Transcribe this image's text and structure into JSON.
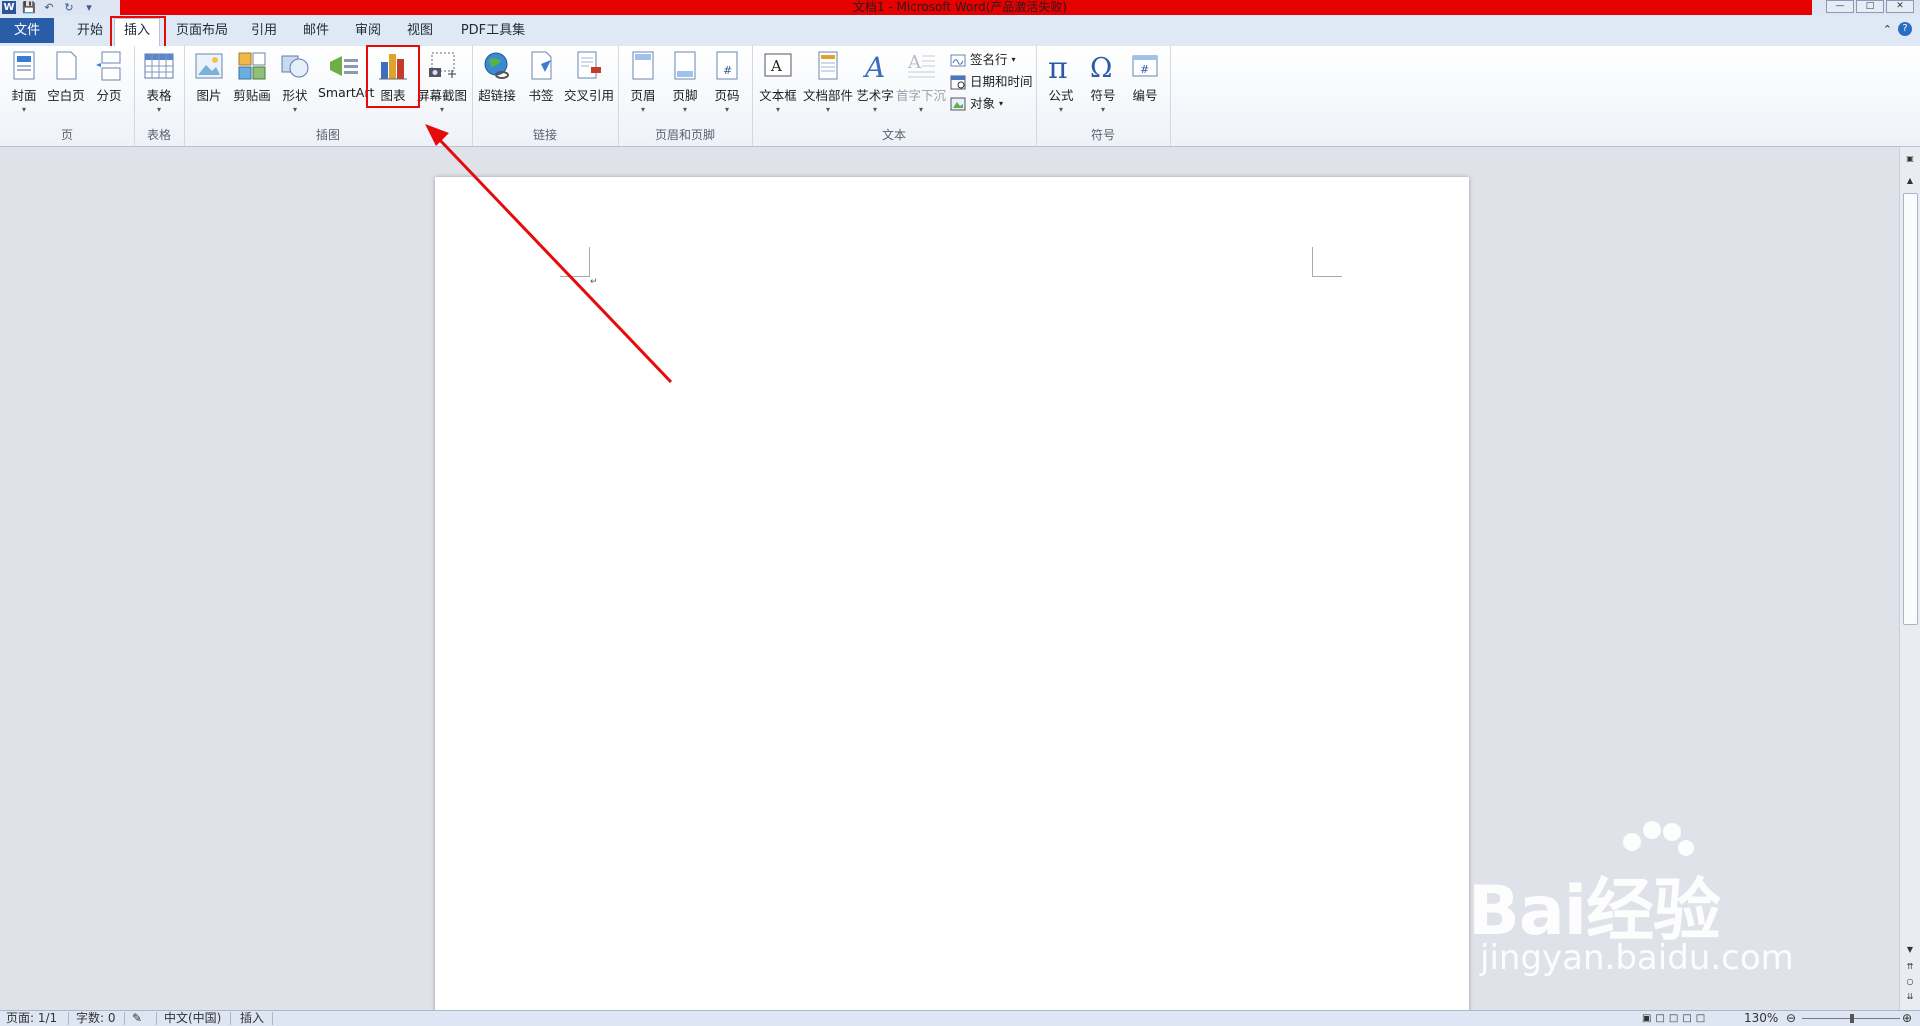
{
  "window": {
    "title": "文档1 - Microsoft Word(产品激活失败)",
    "app_icon_letter": "W"
  },
  "tabs": [
    {
      "label": "文件"
    },
    {
      "label": "开始"
    },
    {
      "label": "插入"
    },
    {
      "label": "页面布局"
    },
    {
      "label": "引用"
    },
    {
      "label": "邮件"
    },
    {
      "label": "审阅"
    },
    {
      "label": "视图"
    },
    {
      "label": "PDF工具集"
    }
  ],
  "ribbon": {
    "groups": {
      "page": {
        "label": "页",
        "buttons": [
          "封面",
          "空白页",
          "分页"
        ]
      },
      "table": {
        "label": "表格",
        "buttons": [
          "表格"
        ]
      },
      "illustrations": {
        "label": "插图",
        "buttons": [
          "图片",
          "剪贴画",
          "形状",
          "SmartArt",
          "图表",
          "屏幕截图"
        ]
      },
      "links": {
        "label": "链接",
        "buttons": [
          "超链接",
          "书签",
          "交叉引用"
        ]
      },
      "header_footer": {
        "label": "页眉和页脚",
        "buttons": [
          "页眉",
          "页脚",
          "页码"
        ]
      },
      "text": {
        "label": "文本",
        "buttons": [
          "文本框",
          "文档部件",
          "艺术字",
          "首字下沉"
        ],
        "small": [
          "签名行",
          "日期和时间",
          "对象"
        ]
      },
      "symbols": {
        "label": "符号",
        "buttons": [
          "公式",
          "符号",
          "编号"
        ]
      }
    }
  },
  "status": {
    "page": "页面: 1/1",
    "words": "字数: 0",
    "language": "中文(中国)",
    "mode": "插入",
    "zoom": "130%"
  },
  "watermark": {
    "brand": "Bai经验",
    "url": "jingyan.baidu.com"
  },
  "colors": {
    "highlight": "#e60b0b",
    "file_tab": "#2a5da8"
  }
}
